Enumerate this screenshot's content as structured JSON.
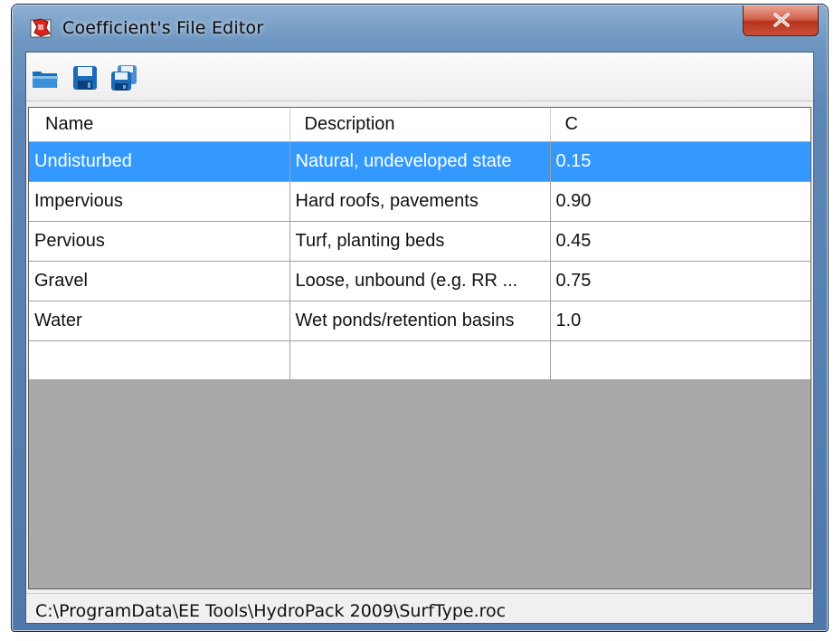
{
  "window": {
    "title": "Coefficient's File Editor",
    "close_label": "X"
  },
  "toolbar": {
    "buttons": [
      {
        "name": "open-button",
        "icon": "folder-open-icon"
      },
      {
        "name": "save-button",
        "icon": "floppy-disk-icon"
      },
      {
        "name": "save-as-button",
        "icon": "floppy-disks-icon"
      }
    ]
  },
  "grid": {
    "columns": [
      "Name",
      "Description",
      "C"
    ],
    "rows": [
      {
        "name": "Undisturbed",
        "description": "Natural, undeveloped state",
        "c": "0.15",
        "selected": true
      },
      {
        "name": "Impervious",
        "description": "Hard roofs, pavements",
        "c": "0.90"
      },
      {
        "name": "Pervious",
        "description": "Turf, planting beds",
        "c": "0.45"
      },
      {
        "name": "Gravel",
        "description": "Loose, unbound (e.g. RR ...",
        "c": "0.75"
      },
      {
        "name": "Water",
        "description": "Wet ponds/retention basins",
        "c": "1.0"
      }
    ]
  },
  "status": {
    "path": "C:\\ProgramData\\EE Tools\\HydroPack 2009\\SurfType.roc"
  },
  "colors": {
    "selection": "#3399ff",
    "grid_empty_area": "#a9a9a9",
    "close_button": "#c9503a"
  }
}
